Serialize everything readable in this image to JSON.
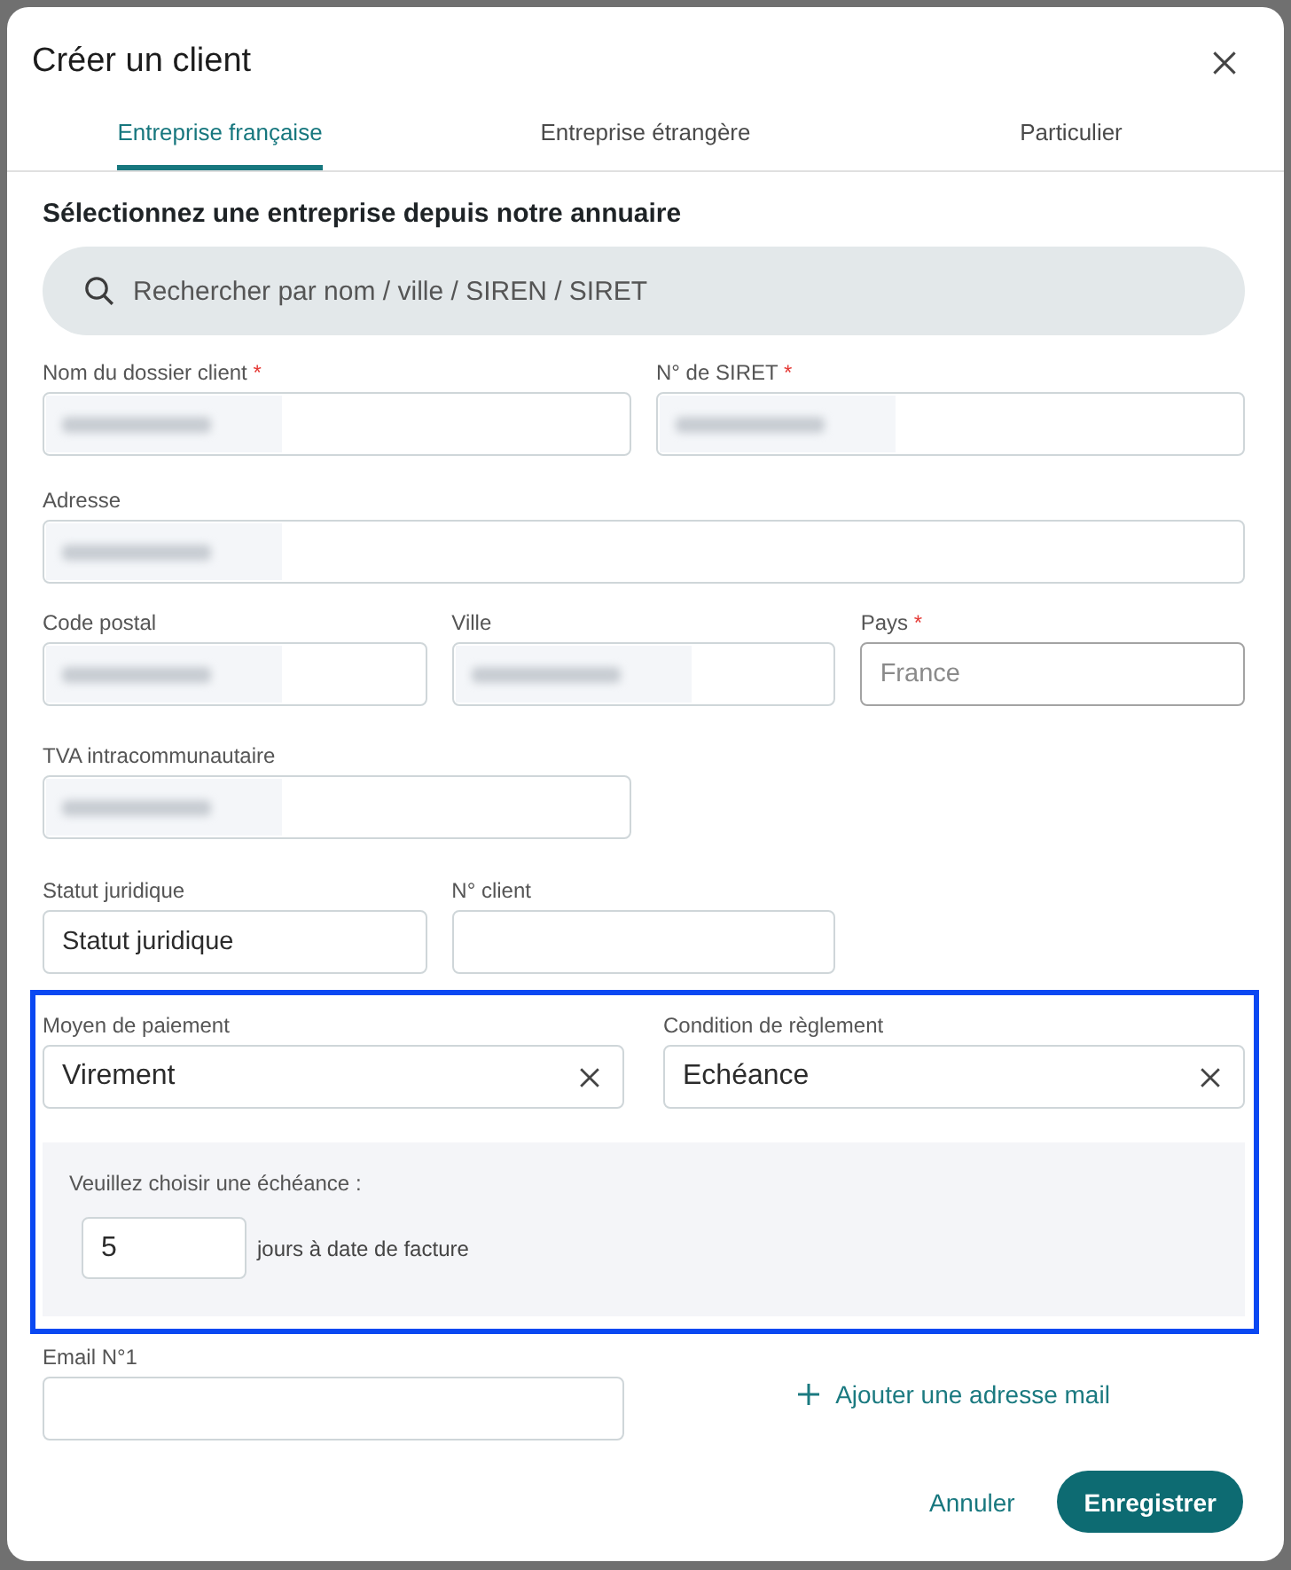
{
  "dialog": {
    "title": "Créer un client"
  },
  "tabs": [
    {
      "label": "Entreprise française",
      "selected": true
    },
    {
      "label": "Entreprise étrangère",
      "selected": false
    },
    {
      "label": "Particulier",
      "selected": false
    }
  ],
  "directory": {
    "heading": "Sélectionnez une entreprise depuis notre annuaire",
    "search": {
      "placeholder": "Rechercher par nom / ville / SIREN / SIRET"
    }
  },
  "field_rows": [
    [
      {
        "label": "Nom du dossier client",
        "required_mark": "*",
        "kind": "input",
        "blurred": true
      },
      {
        "label": "N° de SIRET",
        "required_mark": "*",
        "kind": "input",
        "blurred": true
      }
    ],
    [
      {
        "label": "Adresse",
        "kind": "input",
        "blurred": true
      }
    ],
    [
      {
        "label": "Code postal",
        "kind": "input",
        "blurred": true
      },
      {
        "label": "Ville",
        "kind": "input",
        "blurred": true
      },
      {
        "label": "Pays",
        "required_mark": "*",
        "kind": "autocomplete",
        "blurred": false,
        "placeholder": "France"
      }
    ],
    [
      {
        "label": "TVA intracommunautaire",
        "kind": "input",
        "blurred": true
      }
    ],
    [
      {
        "label": "Statut juridique",
        "kind": "input",
        "blurred": false,
        "value": "Statut juridique"
      },
      {
        "label": "N° client",
        "kind": "input",
        "blurred": false
      }
    ]
  ],
  "payment_section": {
    "highlighted": true,
    "fields": [
      {
        "label": "Moyen de paiement",
        "value": "Virement",
        "clearable": true
      },
      {
        "label": "Condition de règlement",
        "value": "Echéance",
        "clearable": true
      }
    ],
    "due_panel": {
      "prompt": "Veuillez choisir une échéance :",
      "days": "5",
      "suffix": "jours à date de facture"
    }
  },
  "emails": [
    {
      "label": "Email N°1"
    }
  ],
  "add_email_link": "Ajouter une adresse mail",
  "buttons": [
    {
      "label": "Annuler",
      "kind": "text"
    },
    {
      "label": "Enregistrer",
      "kind": "primary"
    }
  ]
}
